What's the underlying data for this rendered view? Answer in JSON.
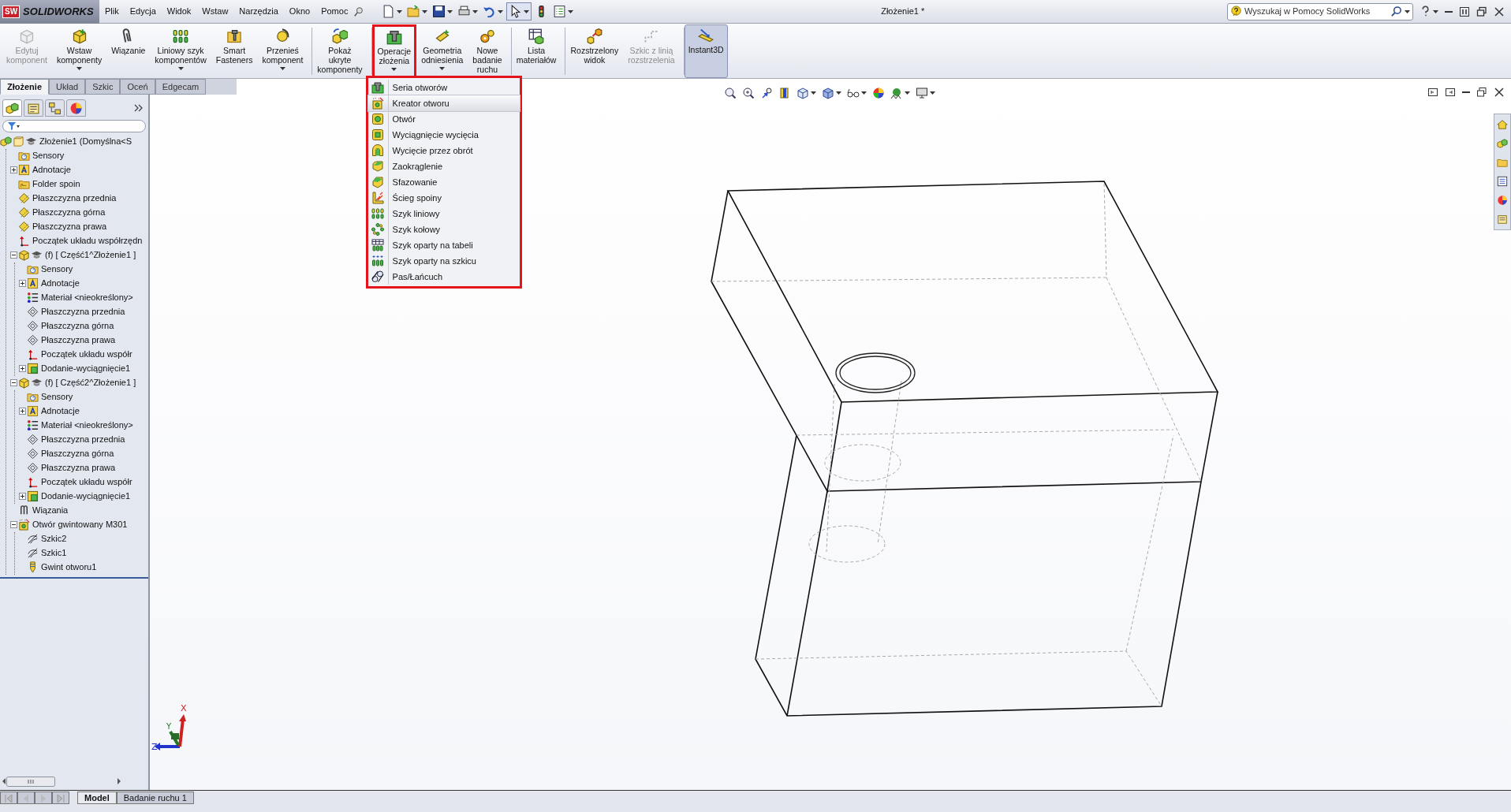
{
  "app": {
    "logo_badge": "SW",
    "logo": "SOLIDWORKS"
  },
  "menu": [
    "Plik",
    "Edycja",
    "Widok",
    "Wstaw",
    "Narzędzia",
    "Okno",
    "Pomoc"
  ],
  "document_title": "Złożenie1 *",
  "search": {
    "placeholder": "Wyszukaj w Pomocy SolidWorks"
  },
  "ribbon": [
    {
      "label": "Edytuj\nkomponent",
      "kind": "edit-component",
      "disabled": true,
      "dropdown": false,
      "pressed": false,
      "expanded": false
    },
    {
      "label": "Wstaw\nkomponenty",
      "kind": "insert-components",
      "disabled": false,
      "dropdown": true,
      "pressed": false,
      "expanded": false
    },
    {
      "label": "Wiązanie",
      "kind": "mate",
      "disabled": false,
      "dropdown": false,
      "pressed": false,
      "expanded": false
    },
    {
      "label": "Liniowy szyk\nkomponentów",
      "kind": "linear-pattern",
      "disabled": false,
      "dropdown": true,
      "pressed": false,
      "expanded": false
    },
    {
      "label": "Smart\nFasteners",
      "kind": "smart-fasteners",
      "disabled": false,
      "dropdown": false,
      "pressed": false,
      "expanded": false
    },
    {
      "label": "Przenieś\nkomponent",
      "kind": "move-component",
      "disabled": false,
      "dropdown": true,
      "pressed": false,
      "expanded": false
    },
    {
      "label": "Pokaż\nukryte\nkomponenty",
      "kind": "show-hidden",
      "separator_before": true,
      "disabled": false,
      "dropdown": false,
      "pressed": false,
      "expanded": false
    },
    {
      "label": "Operacje\nzłożenia",
      "kind": "assembly-features",
      "separator_before": true,
      "disabled": false,
      "dropdown": true,
      "pressed": false,
      "expanded": true
    },
    {
      "label": "Geometria\nodniesienia",
      "kind": "reference-geometry",
      "disabled": false,
      "dropdown": true,
      "pressed": false,
      "expanded": false
    },
    {
      "label": "Nowe\nbadanie\nruchu",
      "kind": "motion-study",
      "disabled": false,
      "dropdown": false,
      "pressed": false,
      "expanded": false
    },
    {
      "label": "Lista\nmateriałów",
      "kind": "bom",
      "separator_before": true,
      "disabled": false,
      "dropdown": false,
      "pressed": false,
      "expanded": false
    },
    {
      "label": "Rozstrzelony\nwidok",
      "kind": "exploded-view",
      "separator_before": true,
      "disabled": false,
      "dropdown": false,
      "pressed": false,
      "expanded": false
    },
    {
      "label": "Szkic z linią\nrozstrzelenia",
      "kind": "explode-line",
      "disabled": true,
      "dropdown": false,
      "pressed": false,
      "expanded": false
    },
    {
      "label": "Instant3D",
      "kind": "instant3d",
      "separator_before": true,
      "disabled": false,
      "dropdown": false,
      "pressed": true,
      "expanded": false
    }
  ],
  "command_tabs": [
    {
      "label": "Złożenie",
      "selected": true
    },
    {
      "label": "Układ",
      "selected": false
    },
    {
      "label": "Szkic",
      "selected": false
    },
    {
      "label": "Oceń",
      "selected": false
    },
    {
      "label": "Edgecam",
      "selected": false
    }
  ],
  "feature_tree": [
    {
      "label": "Złożenie1  (Domyślna<S",
      "kind": "assembly",
      "children": [
        {
          "label": "Sensory",
          "kind": "sensor"
        },
        {
          "label": "Adnotacje",
          "kind": "annotation",
          "expanded": false
        },
        {
          "label": "Folder spoin",
          "kind": "weld-folder"
        },
        {
          "label": "Płaszczyzna przednia",
          "kind": "plane"
        },
        {
          "label": "Płaszczyzna górna",
          "kind": "plane"
        },
        {
          "label": "Płaszczyzna prawa",
          "kind": "plane"
        },
        {
          "label": "Początek układu współrzędn",
          "kind": "origin"
        },
        {
          "label": "(f) [ Część1^Złożenie1 ]",
          "kind": "part",
          "expanded": true,
          "children": [
            {
              "label": "Sensory",
              "kind": "sensor"
            },
            {
              "label": "Adnotacje",
              "kind": "annotation",
              "expanded": false
            },
            {
              "label": "Materiał <nieokreślony>",
              "kind": "material"
            },
            {
              "label": "Płaszczyzna przednia",
              "kind": "part-plane"
            },
            {
              "label": "Płaszczyzna górna",
              "kind": "part-plane"
            },
            {
              "label": "Płaszczyzna prawa",
              "kind": "part-plane"
            },
            {
              "label": "Początek układu współr",
              "kind": "origin"
            },
            {
              "label": "Dodanie-wyciągnięcie1",
              "kind": "extrude",
              "expanded": false
            }
          ]
        },
        {
          "label": "(f) [ Część2^Złożenie1 ]",
          "kind": "part",
          "expanded": true,
          "children": [
            {
              "label": "Sensory",
              "kind": "sensor"
            },
            {
              "label": "Adnotacje",
              "kind": "annotation",
              "expanded": false
            },
            {
              "label": "Materiał <nieokreślony>",
              "kind": "material"
            },
            {
              "label": "Płaszczyzna przednia",
              "kind": "part-plane"
            },
            {
              "label": "Płaszczyzna górna",
              "kind": "part-plane"
            },
            {
              "label": "Płaszczyzna prawa",
              "kind": "part-plane"
            },
            {
              "label": "Początek układu współr",
              "kind": "origin"
            },
            {
              "label": "Dodanie-wyciągnięcie1",
              "kind": "extrude",
              "expanded": false
            }
          ]
        },
        {
          "label": "Wiązania",
          "kind": "mates"
        },
        {
          "label": "Otwór gwintowany M301",
          "kind": "hole-wizard",
          "expanded": true,
          "children": [
            {
              "label": "Szkic2",
              "kind": "sketch"
            },
            {
              "label": "Szkic1",
              "kind": "sketch"
            },
            {
              "label": "Gwint otworu1",
              "kind": "thread"
            }
          ]
        }
      ]
    }
  ],
  "assembly_features_menu": {
    "highlighted": true,
    "items": [
      {
        "label": "Seria otworów",
        "kind": "hole-series",
        "selected": false
      },
      {
        "label": "Kreator otworu",
        "kind": "hole-wizard",
        "selected": true
      },
      {
        "label": "Otwór",
        "kind": "hole",
        "selected": false
      },
      {
        "label": "Wyciągnięcie wycięcia",
        "kind": "extruded-cut",
        "selected": false
      },
      {
        "label": "Wycięcie przez obrót",
        "kind": "revolved-cut",
        "selected": false
      },
      {
        "label": "Zaokrąglenie",
        "kind": "fillet",
        "selected": false
      },
      {
        "label": "Sfazowanie",
        "kind": "chamfer",
        "selected": false
      },
      {
        "label": "Ścieg spoiny",
        "kind": "weld-bead",
        "selected": false
      },
      {
        "label": "Szyk liniowy",
        "kind": "linear-pattern",
        "selected": false
      },
      {
        "label": "Szyk kołowy",
        "kind": "circular-pattern",
        "selected": false
      },
      {
        "label": "Szyk oparty na tabeli",
        "kind": "table-pattern",
        "selected": false
      },
      {
        "label": "Szyk oparty na szkicu",
        "kind": "sketch-pattern",
        "selected": false
      },
      {
        "label": "Pas/Łańcuch",
        "kind": "belt-chain",
        "selected": false
      }
    ]
  },
  "triad": {
    "x": "X",
    "y": "Y",
    "z": "Z"
  },
  "bottom_tabs": [
    {
      "label": "Model",
      "selected": true
    },
    {
      "label": "Badanie ruchu 1",
      "selected": false
    }
  ]
}
